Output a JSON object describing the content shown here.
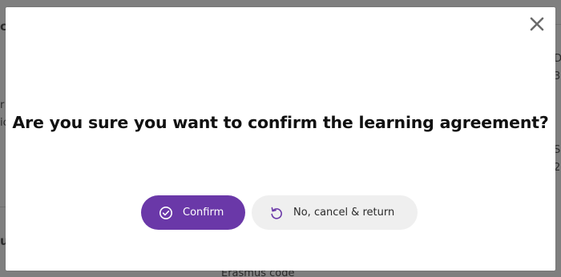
{
  "modal": {
    "title": "Are you sure you want to confirm the learning agreement?",
    "close_icon": "close-icon",
    "confirm_button": {
      "label": "Confirm",
      "icon": "check-circle-icon",
      "color": "#6a38a8"
    },
    "cancel_button": {
      "label": "No, cancel & return",
      "icon": "undo-icon",
      "icon_color": "#6a38a8"
    }
  },
  "background": {
    "overlay_color": "#7f7f7f",
    "fragments": {
      "top_left": "ca",
      "mid_left_1": "r",
      "mid_left_2": "ic",
      "bottom_left": "u",
      "bottom_center": "Erasmus code",
      "right_1": "D",
      "right_2": "3",
      "right_3": "S",
      "right_4": "2"
    }
  }
}
